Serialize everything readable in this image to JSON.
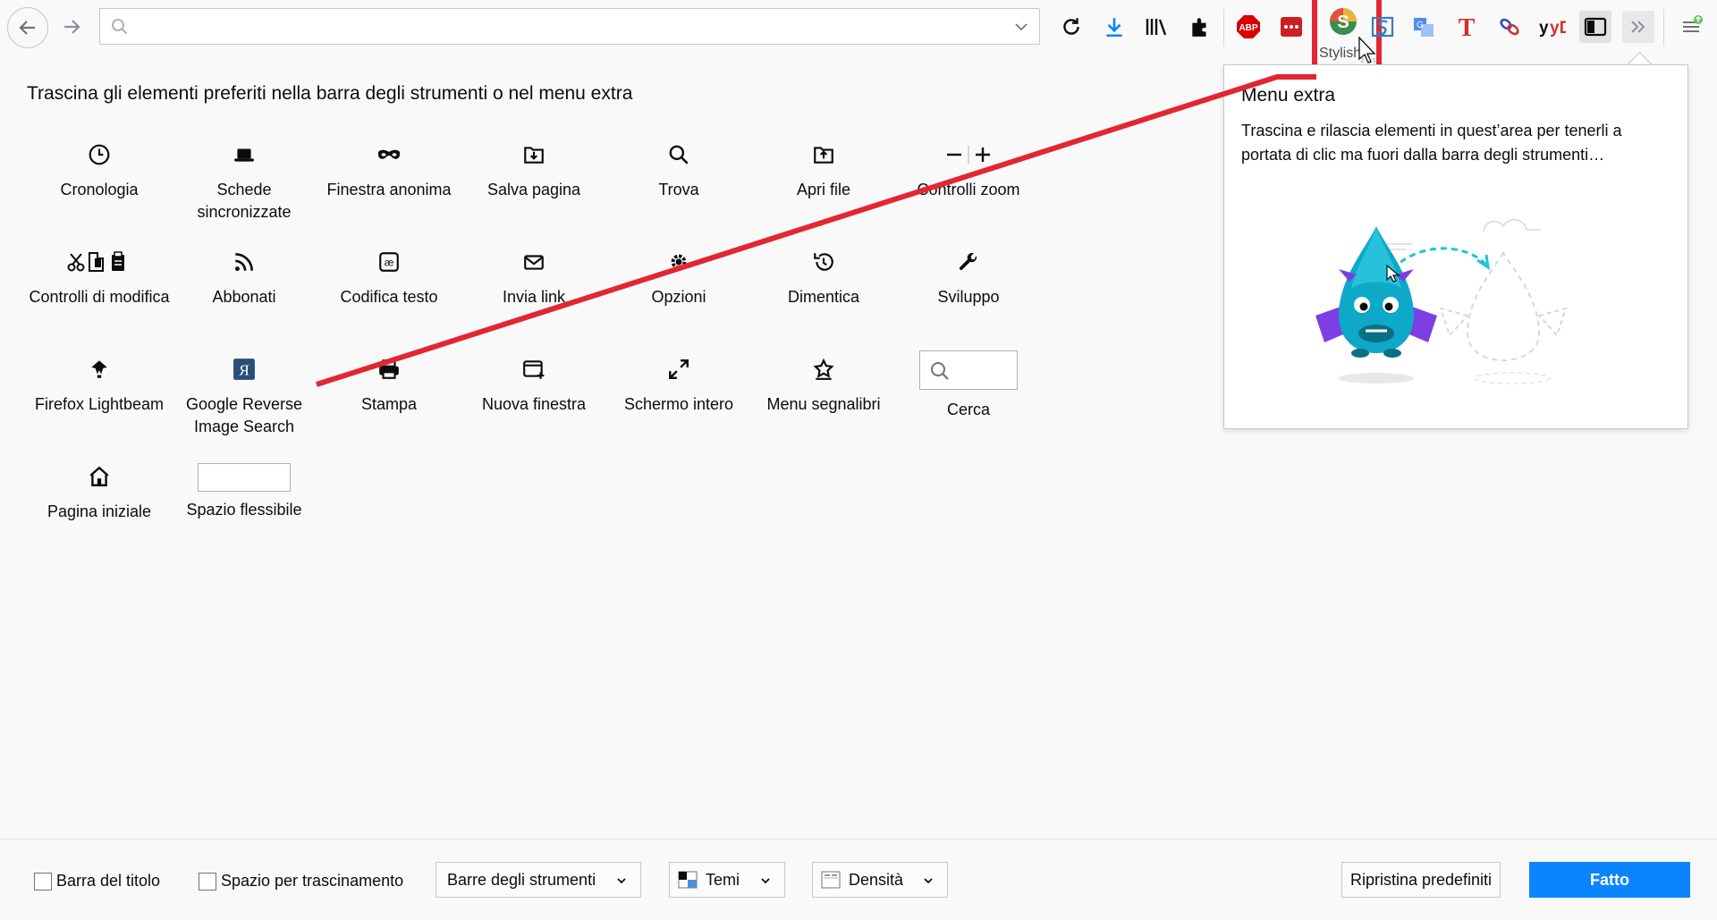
{
  "toolbar": {
    "url_value": "",
    "url_placeholder": "",
    "tooltip": "Stylish",
    "icons": [
      "back-icon",
      "forward-icon",
      "reload-icon",
      "download-icon",
      "library-icon",
      "extensions-icon",
      "adblock-plus-icon",
      "lastpass-icon",
      "stylish-icon",
      "stylus-icon",
      "translate-icon",
      "t-icon",
      "link-icon",
      "yandex-dictionary-icon",
      "sidebar-icon",
      "overflow-chevron-icon",
      "menu-icon"
    ],
    "abp_label": "ABP",
    "yd_label": "yD"
  },
  "palette": {
    "title": "Trascina gli elementi preferiti nella barra degli strumenti o nel menu extra",
    "items": [
      {
        "label": "Cronologia",
        "icon": "clock-icon"
      },
      {
        "label": "Schede sincronizzate",
        "icon": "laptop-icon"
      },
      {
        "label": "Finestra anonima",
        "icon": "mask-icon"
      },
      {
        "label": "Salva pagina",
        "icon": "save-page-icon"
      },
      {
        "label": "Trova",
        "icon": "search-icon"
      },
      {
        "label": "Apri file",
        "icon": "open-file-icon"
      },
      {
        "label": "Controlli zoom",
        "icon": "zoom-controls-icon"
      },
      {
        "label": "Controlli di modifica",
        "icon": "edit-controls-icon"
      },
      {
        "label": "Abbonati",
        "icon": "feed-icon"
      },
      {
        "label": "Codifica testo",
        "icon": "text-encoding-icon"
      },
      {
        "label": "Invia link",
        "icon": "email-icon"
      },
      {
        "label": "Opzioni",
        "icon": "gear-icon"
      },
      {
        "label": "Dimentica",
        "icon": "forget-icon"
      },
      {
        "label": "Sviluppo",
        "icon": "wrench-icon"
      },
      {
        "label": "Firefox Lightbeam",
        "icon": "lightbeam-icon"
      },
      {
        "label": "Google Reverse Image Search",
        "icon": "yandex-icon"
      },
      {
        "label": "Stampa",
        "icon": "print-icon"
      },
      {
        "label": "Nuova finestra",
        "icon": "new-window-icon"
      },
      {
        "label": "Schermo intero",
        "icon": "fullscreen-icon"
      },
      {
        "label": "Menu segnalibri",
        "icon": "bookmarks-menu-icon"
      },
      {
        "label": "Cerca",
        "icon": "search-widget"
      },
      {
        "label": "Pagina iniziale",
        "icon": "home-icon"
      },
      {
        "label": "Spazio flessibile",
        "icon": "flexible-space"
      }
    ],
    "yandex_glyph": "Я"
  },
  "panel": {
    "title": "Menu extra",
    "description": "Trascina e rilascia elementi in quest’area per tenerli a portata di clic ma fuori dalla barra degli strumenti…"
  },
  "footer": {
    "title_bar_label": "Barra del titolo",
    "drag_space_label": "Spazio per trascinamento",
    "title_bar_checked": false,
    "drag_space_checked": false,
    "toolbars_label": "Barre degli strumenti",
    "themes_label": "Temi",
    "density_label": "Densità",
    "reset_label": "Ripristina predefiniti",
    "done_label": "Fatto"
  },
  "colors": {
    "accent": "#0a84ff",
    "annotation": "#e22633",
    "abp_red": "#d70000",
    "lastpass_red": "#cc1f24"
  }
}
